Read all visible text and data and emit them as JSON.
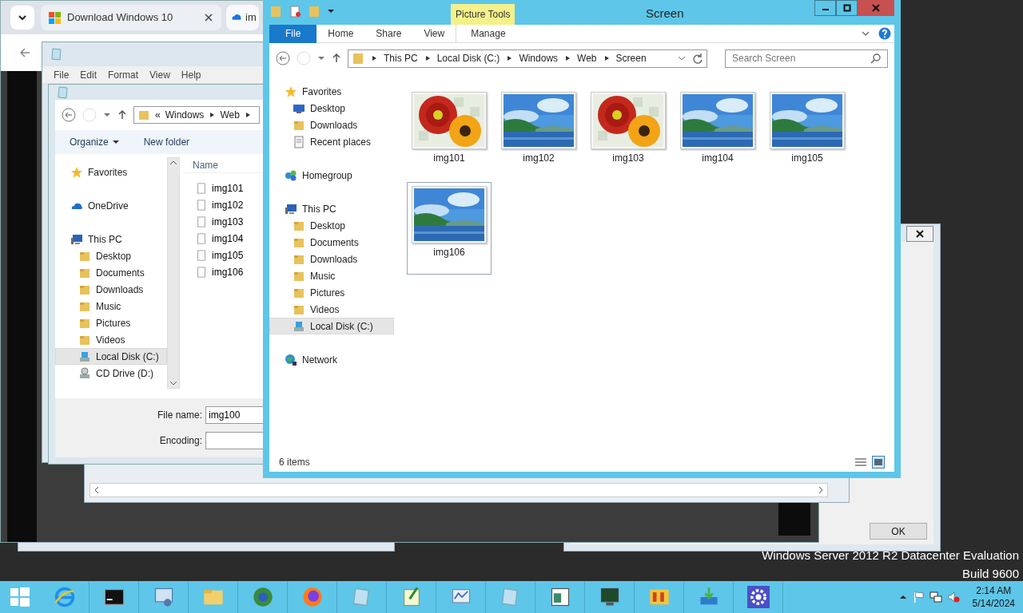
{
  "browser": {
    "tabs": [
      {
        "label": "Download Windows 10",
        "selected": true
      },
      {
        "label": "im",
        "selected": false
      }
    ]
  },
  "notepad": {
    "menu": [
      "File",
      "Edit",
      "Format",
      "View",
      "Help"
    ]
  },
  "save_dialog": {
    "path_overflow": "«",
    "breadcrumb": [
      "Windows",
      "Web"
    ],
    "organize": "Organize",
    "new_folder": "New folder",
    "nav": [
      {
        "label": "Favorites",
        "kind": "star",
        "selected": false
      },
      {
        "label": "OneDrive",
        "kind": "cloud",
        "selected": false
      },
      {
        "label": "This PC",
        "kind": "pc",
        "selected": false,
        "children": [
          {
            "label": "Desktop",
            "kind": "folder",
            "selected": false
          },
          {
            "label": "Documents",
            "kind": "folder",
            "selected": false
          },
          {
            "label": "Downloads",
            "kind": "folder",
            "selected": false
          },
          {
            "label": "Music",
            "kind": "folder",
            "selected": false
          },
          {
            "label": "Pictures",
            "kind": "folder",
            "selected": false
          },
          {
            "label": "Videos",
            "kind": "folder",
            "selected": false
          },
          {
            "label": "Local Disk (C:)",
            "kind": "drive",
            "selected": true
          },
          {
            "label": "CD Drive (D:)",
            "kind": "cd",
            "selected": false
          }
        ]
      }
    ],
    "column": "Name",
    "files": [
      "img101",
      "img102",
      "img103",
      "img104",
      "img105",
      "img106"
    ],
    "file_name_label": "File name:",
    "file_name": "img100",
    "encoding_label": "Encoding:"
  },
  "explorer": {
    "title": "Screen",
    "contextual_label": "Picture Tools",
    "ribbon_tabs": [
      {
        "label": "File",
        "kind": "file",
        "selected": false
      },
      {
        "label": "Home",
        "kind": "tab",
        "selected": false
      },
      {
        "label": "Share",
        "kind": "tab",
        "selected": false
      },
      {
        "label": "View",
        "kind": "tab",
        "selected": false
      },
      {
        "label": "Manage",
        "kind": "contextual",
        "selected": false
      }
    ],
    "breadcrumb": [
      "This PC",
      "Local Disk (C:)",
      "Windows",
      "Web",
      "Screen"
    ],
    "search": {
      "placeholder": "Search Screen"
    },
    "nav": [
      {
        "label": "Favorites",
        "kind": "star",
        "selected": false,
        "children": [
          {
            "label": "Desktop",
            "kind": "desktop",
            "selected": false
          },
          {
            "label": "Downloads",
            "kind": "folder",
            "selected": false
          },
          {
            "label": "Recent places",
            "kind": "recent",
            "selected": false
          }
        ]
      },
      {
        "label": "Homegroup",
        "kind": "homegroup",
        "selected": false
      },
      {
        "label": "This PC",
        "kind": "pc",
        "selected": false,
        "children": [
          {
            "label": "Desktop",
            "kind": "folder",
            "selected": false
          },
          {
            "label": "Documents",
            "kind": "folder",
            "selected": false
          },
          {
            "label": "Downloads",
            "kind": "folder",
            "selected": false
          },
          {
            "label": "Music",
            "kind": "folder",
            "selected": false
          },
          {
            "label": "Pictures",
            "kind": "folder",
            "selected": false
          },
          {
            "label": "Videos",
            "kind": "folder",
            "selected": false
          },
          {
            "label": "Local Disk (C:)",
            "kind": "drive",
            "selected": true
          }
        ]
      },
      {
        "label": "Network",
        "kind": "network",
        "selected": false
      }
    ],
    "items": [
      {
        "name": "img101",
        "selected": false
      },
      {
        "name": "img102",
        "selected": false
      },
      {
        "name": "img103",
        "selected": false
      },
      {
        "name": "img104",
        "selected": false
      },
      {
        "name": "img105",
        "selected": false
      },
      {
        "name": "img106",
        "selected": true
      }
    ],
    "status": "6 items"
  },
  "dialog": {
    "ok": "OK"
  },
  "desktop_text": [
    "Windows Server 2012 R2 Datacenter Evaluation",
    "Build 9600"
  ],
  "taskbar": {
    "time": "2:14 AM",
    "date": "5/14/2024"
  }
}
